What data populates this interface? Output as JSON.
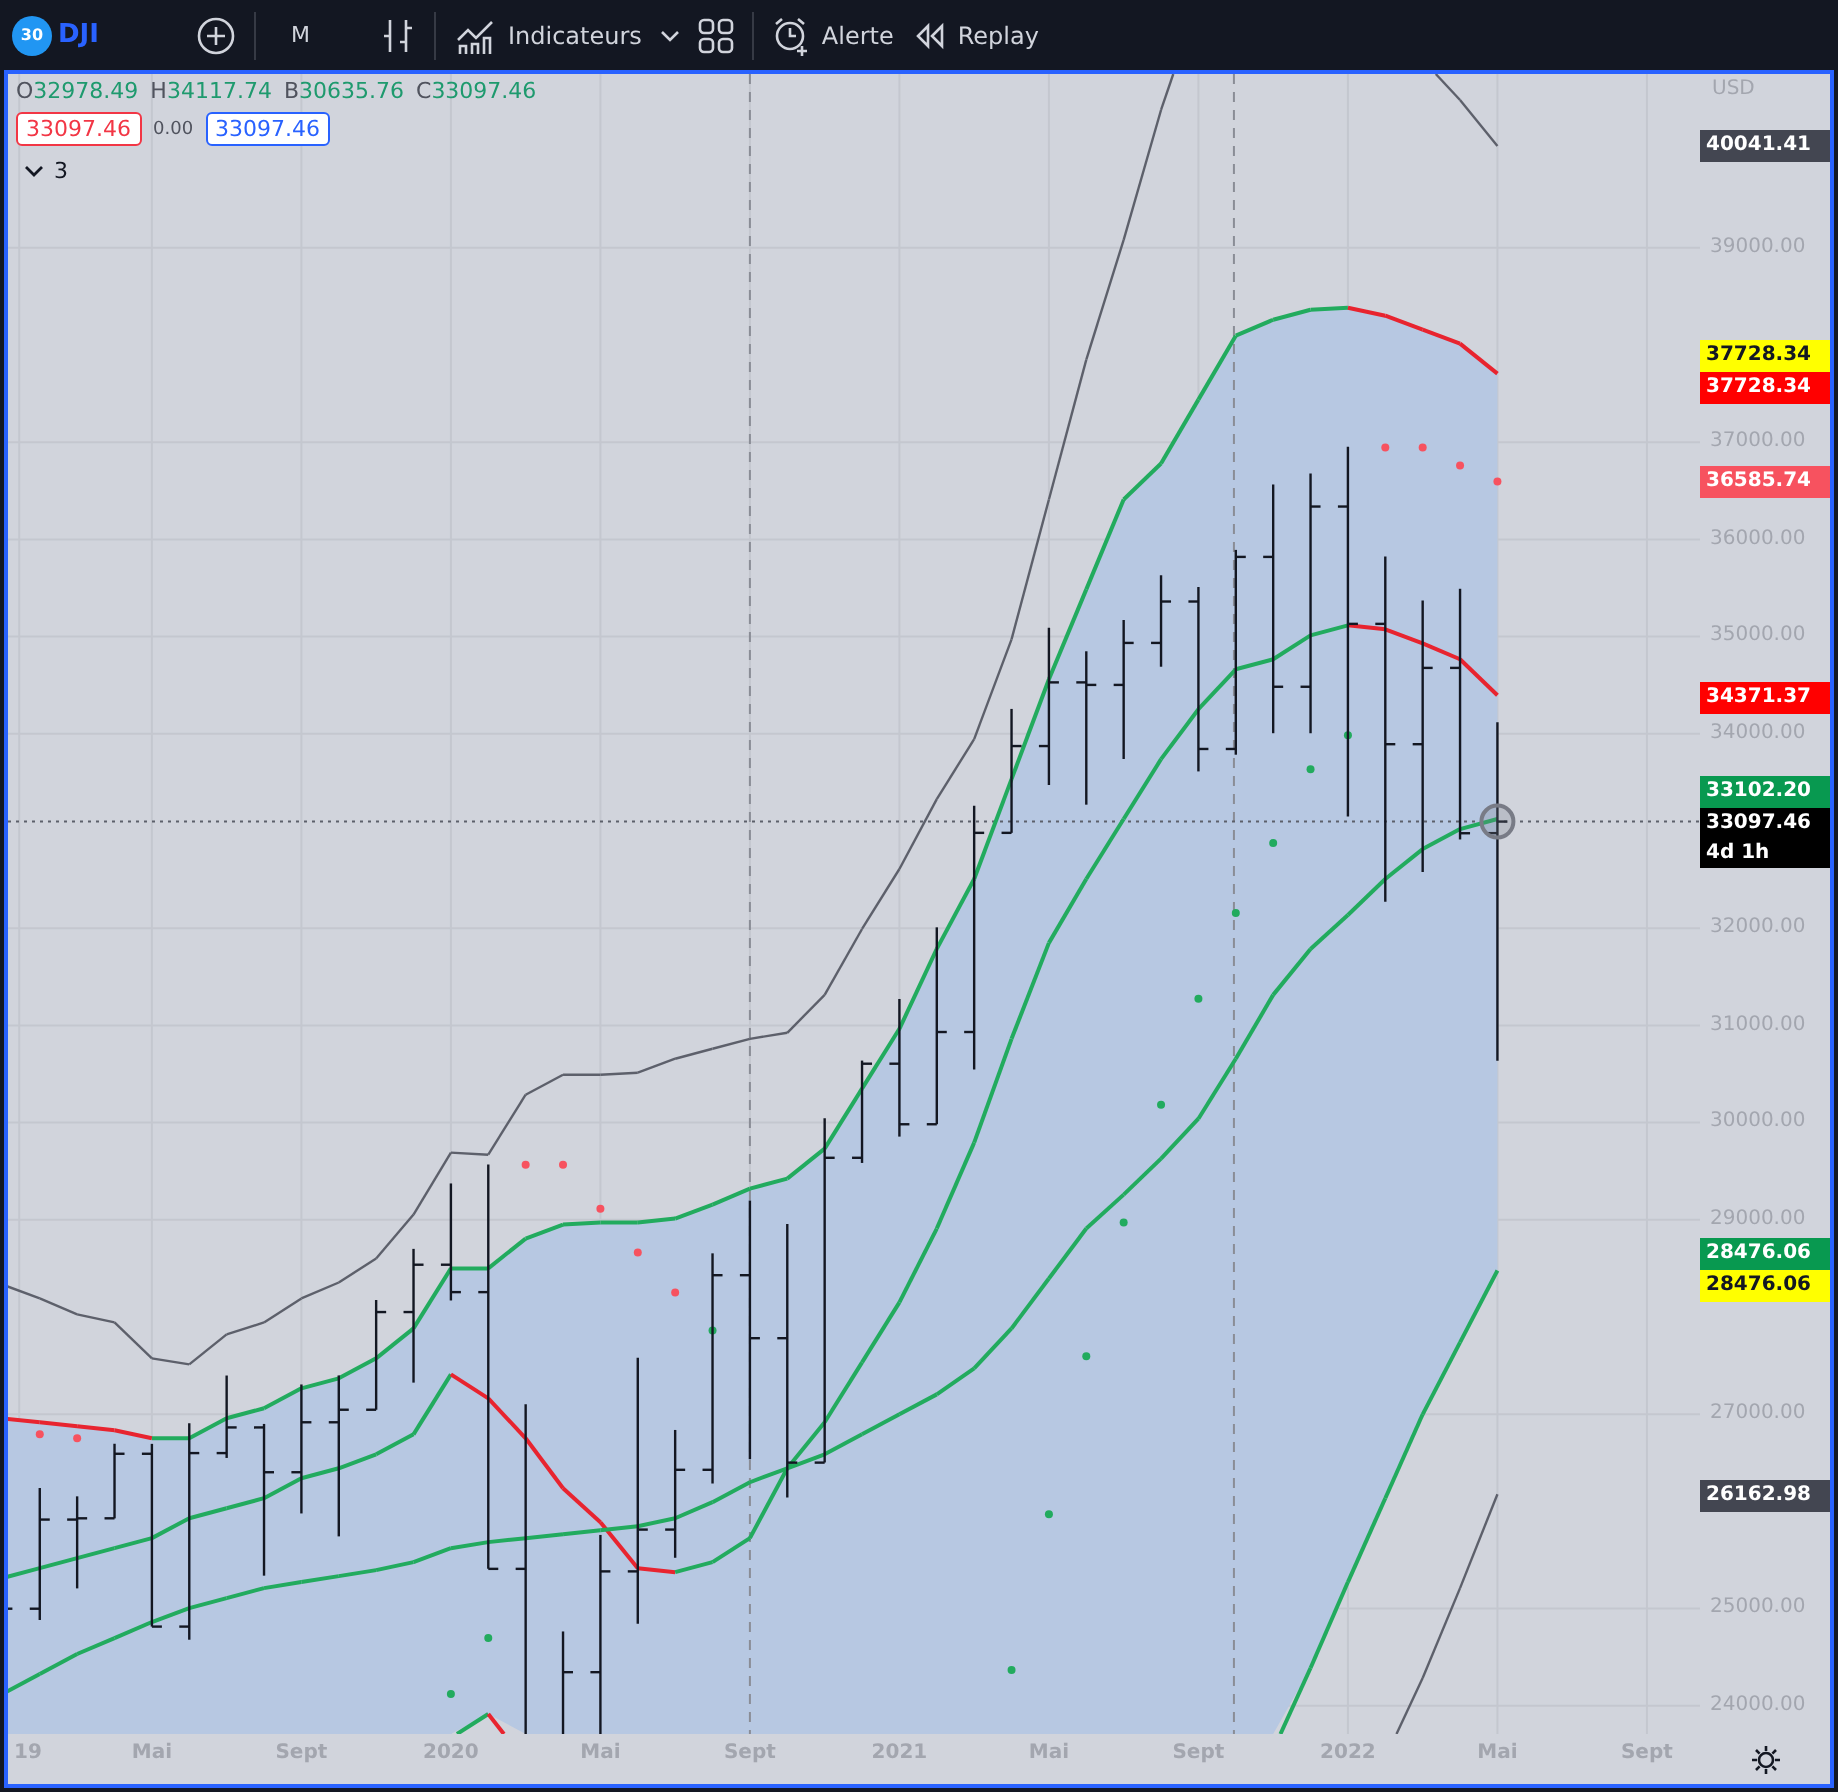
{
  "toolbar": {
    "symbol_badge": "30",
    "symbol": "DJI",
    "interval": "M",
    "indicators_label": "Indicateurs",
    "alert_label": "Alerte",
    "replay_label": "Replay"
  },
  "legend": {
    "ohlc": [
      {
        "letter": "O",
        "value": "32978.49"
      },
      {
        "letter": "H",
        "value": "34117.74"
      },
      {
        "letter": "B",
        "value": "30635.76"
      },
      {
        "letter": "C",
        "value": "33097.46"
      }
    ],
    "sell_price": "33097.46",
    "spread": "0.00",
    "buy_price": "33097.46",
    "collapse_count": "3"
  },
  "price_axis": {
    "currency": "USD",
    "ticks": [
      "39000.00",
      "37000.00",
      "36000.00",
      "35000.00",
      "34000.00",
      "32000.00",
      "31000.00",
      "30000.00",
      "29000.00",
      "27000.00",
      "25000.00",
      "24000.00"
    ],
    "labels": [
      {
        "text": "40041.41",
        "color": "#434651"
      },
      {
        "text": "37728.34",
        "color": "#ffff00"
      },
      {
        "text": "37728.34",
        "color": "#ff0000"
      },
      {
        "text": "36585.74",
        "color": "#f7525f"
      },
      {
        "text": "34371.37",
        "color": "#ff0000"
      },
      {
        "text": "33102.20",
        "color": "#089950"
      },
      {
        "text": "33097.46",
        "color": "#000000",
        "countdown": "4d 1h"
      },
      {
        "text": "28476.06",
        "color": "#089950"
      },
      {
        "text": "28476.06",
        "color": "#ffff00"
      },
      {
        "text": "26162.98",
        "color": "#434651"
      }
    ]
  },
  "time_axis": {
    "ticks": [
      "19",
      "Mai",
      "Sept",
      "2020",
      "Mai",
      "Sept",
      "2021",
      "Mai",
      "Sept",
      "2022",
      "Mai",
      "Sept"
    ]
  }
}
